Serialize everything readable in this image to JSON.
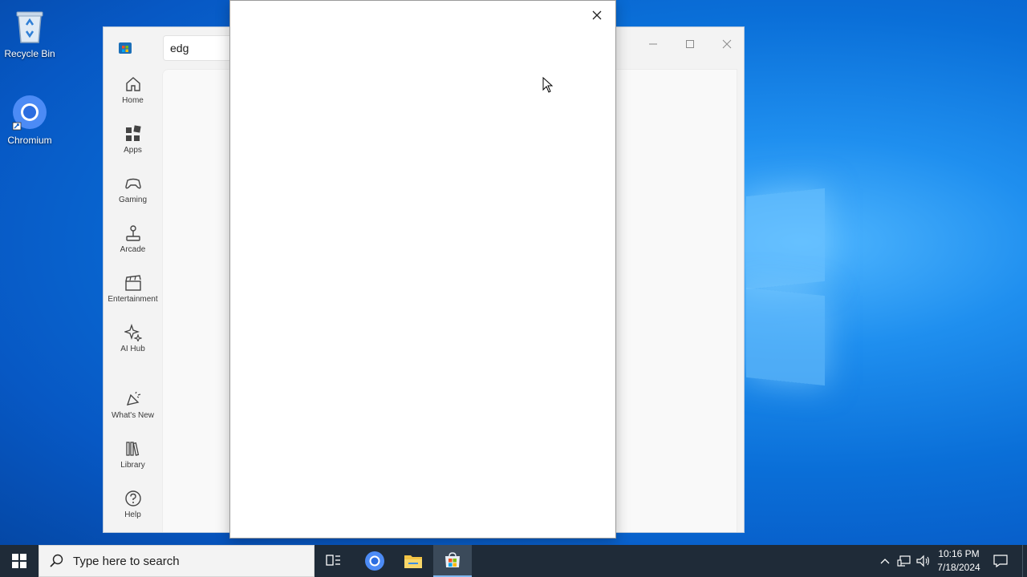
{
  "desktop": {
    "icons": [
      {
        "label": "Recycle Bin",
        "icon": "recycle-bin-icon"
      },
      {
        "label": "Chromium",
        "icon": "chromium-icon"
      }
    ]
  },
  "store_window": {
    "search_value": "edg",
    "nav": [
      {
        "label": "Home",
        "icon": "home-icon"
      },
      {
        "label": "Apps",
        "icon": "apps-icon"
      },
      {
        "label": "Gaming",
        "icon": "gamepad-icon"
      },
      {
        "label": "Arcade",
        "icon": "joystick-icon"
      },
      {
        "label": "Entertainment",
        "icon": "clapperboard-icon"
      },
      {
        "label": "AI Hub",
        "icon": "sparkle-icon"
      },
      {
        "label": "What's New",
        "icon": "megaphone-icon"
      },
      {
        "label": "Library",
        "icon": "library-icon"
      },
      {
        "label": "Help",
        "icon": "help-icon"
      }
    ]
  },
  "taskbar": {
    "search_placeholder": "Type here to search",
    "time": "10:16 PM",
    "date": "7/18/2024"
  },
  "colors": {
    "accent": "#0a6fd8",
    "taskbar": "#1f2b38"
  }
}
